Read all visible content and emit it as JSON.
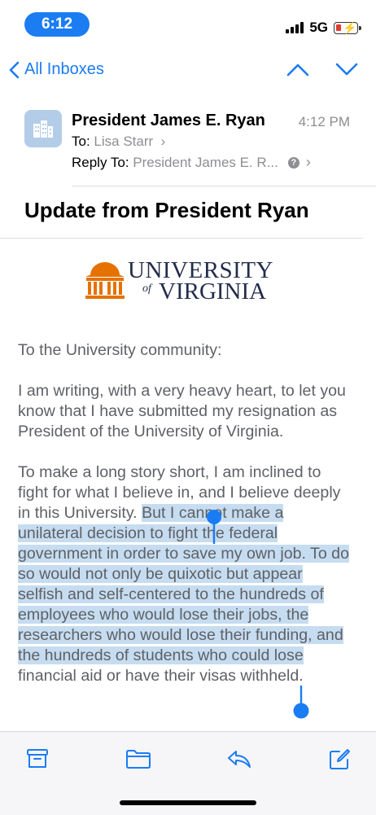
{
  "status_bar": {
    "time": "6:12",
    "network": "5G"
  },
  "nav": {
    "back_label": "All Inboxes"
  },
  "email": {
    "sender": "President James E. Ryan",
    "time": "4:12 PM",
    "to_label": "To:",
    "to": "Lisa Starr",
    "reply_to_label": "Reply To:",
    "reply_to": "President James E. R...",
    "subject": "Update from President Ryan",
    "logo": {
      "line1": "UNIVERSITY",
      "of": "of",
      "line2": "VIRGINIA"
    },
    "paragraphs": [
      "To the University community:",
      "I am writing, with a very heavy heart, to let you know that I have submitted my resignation as President of the University of Virginia."
    ],
    "p3_before": "To make a long story short, I am inclined to fight for what I believe in, and I believe deeply in this University. ",
    "p3_selected": "But I cannot make a unilateral decision to fight the federal government in order to save my own job.  To do so would not only be quixotic but appear selfish and self-centered to the hundreds of employees who would lose their jobs, the researchers who would lose their funding, and the hundreds of students who could lose",
    "p3_after": " financial aid or have their visas withheld."
  },
  "colors": {
    "accent": "#1a7cf3",
    "selection": "#c6dcf0",
    "uva_orange": "#e57200",
    "uva_navy": "#232d4b"
  },
  "toolbar": {
    "icons": [
      "archive-icon",
      "folder-icon",
      "reply-icon",
      "compose-icon"
    ]
  }
}
